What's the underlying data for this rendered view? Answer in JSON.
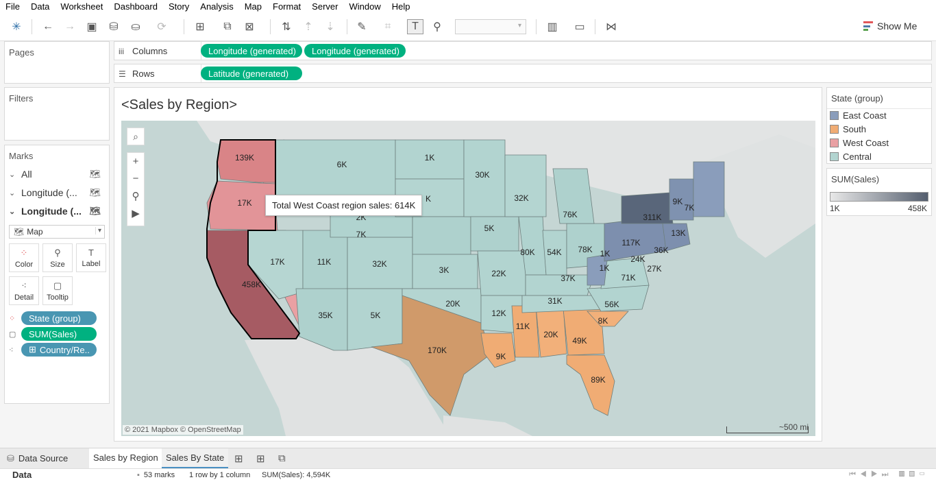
{
  "menu": [
    "File",
    "Data",
    "Worksheet",
    "Dashboard",
    "Story",
    "Analysis",
    "Map",
    "Format",
    "Server",
    "Window",
    "Help"
  ],
  "toolbar": {
    "show_me": "Show Me"
  },
  "pages": {
    "title": "Pages"
  },
  "filters": {
    "title": "Filters"
  },
  "columns": {
    "label": "Columns",
    "pills": [
      "Longitude (generated)",
      "Longitude (generated)"
    ]
  },
  "rows": {
    "label": "Rows",
    "pills": [
      "Latitude (generated)"
    ]
  },
  "marks": {
    "title": "Marks",
    "cards": [
      "All",
      "Longitude (...",
      "Longitude (..."
    ],
    "mark_type": "Map",
    "buttons": [
      "Color",
      "Size",
      "Label",
      "Detail",
      "Tooltip"
    ],
    "pills": [
      "State (group)",
      "SUM(Sales)",
      "Country/Re.."
    ]
  },
  "viz": {
    "title": "<Sales by Region>",
    "tooltip": "Total West Coast region sales: 614K",
    "credits": "© 2021 Mapbox © OpenStreetMap",
    "scale": "~500 mi"
  },
  "map_labels": [
    {
      "text": "139K"
    },
    {
      "text": "17K"
    },
    {
      "text": "458K"
    },
    {
      "text": "6K"
    },
    {
      "text": "1K"
    },
    {
      "text": "30K"
    },
    {
      "text": "2K"
    },
    {
      "text": "7K"
    },
    {
      "text": "K"
    },
    {
      "text": "32K"
    },
    {
      "text": "76K"
    },
    {
      "text": "5K"
    },
    {
      "text": "17K"
    },
    {
      "text": "11K"
    },
    {
      "text": "32K"
    },
    {
      "text": "3K"
    },
    {
      "text": "80K"
    },
    {
      "text": "54K"
    },
    {
      "text": "78K"
    },
    {
      "text": "22K"
    },
    {
      "text": "37K"
    },
    {
      "text": "35K"
    },
    {
      "text": "5K"
    },
    {
      "text": "20K"
    },
    {
      "text": "12K"
    },
    {
      "text": "31K"
    },
    {
      "text": "56K"
    },
    {
      "text": "170K"
    },
    {
      "text": "11K"
    },
    {
      "text": "20K"
    },
    {
      "text": "49K"
    },
    {
      "text": "8K"
    },
    {
      "text": "9K"
    },
    {
      "text": "89K"
    },
    {
      "text": "1K"
    },
    {
      "text": "9K"
    },
    {
      "text": "7K"
    },
    {
      "text": "311K"
    },
    {
      "text": "13K"
    },
    {
      "text": "117K"
    },
    {
      "text": "36K"
    },
    {
      "text": "24K"
    },
    {
      "text": "27K"
    },
    {
      "text": "1K"
    },
    {
      "text": "71K"
    }
  ],
  "legend_group": {
    "title": "State (group)",
    "items": [
      {
        "label": "East Coast",
        "color": "#8a9dbb"
      },
      {
        "label": "South",
        "color": "#f0ac74"
      },
      {
        "label": "West Coast",
        "color": "#e9a0a3"
      },
      {
        "label": "Central",
        "color": "#b2d4d0"
      }
    ]
  },
  "legend_sales": {
    "title": "SUM(Sales)",
    "min": "1K",
    "max": "458K"
  },
  "tabs": {
    "data_source": "Data Source",
    "sheet1": "Sales by Region",
    "sheet2": "Sales By State"
  },
  "status": {
    "source": "Data",
    "marks": "53 marks",
    "layout": "1 row by 1 column",
    "sum": "SUM(Sales): 4,594K"
  }
}
